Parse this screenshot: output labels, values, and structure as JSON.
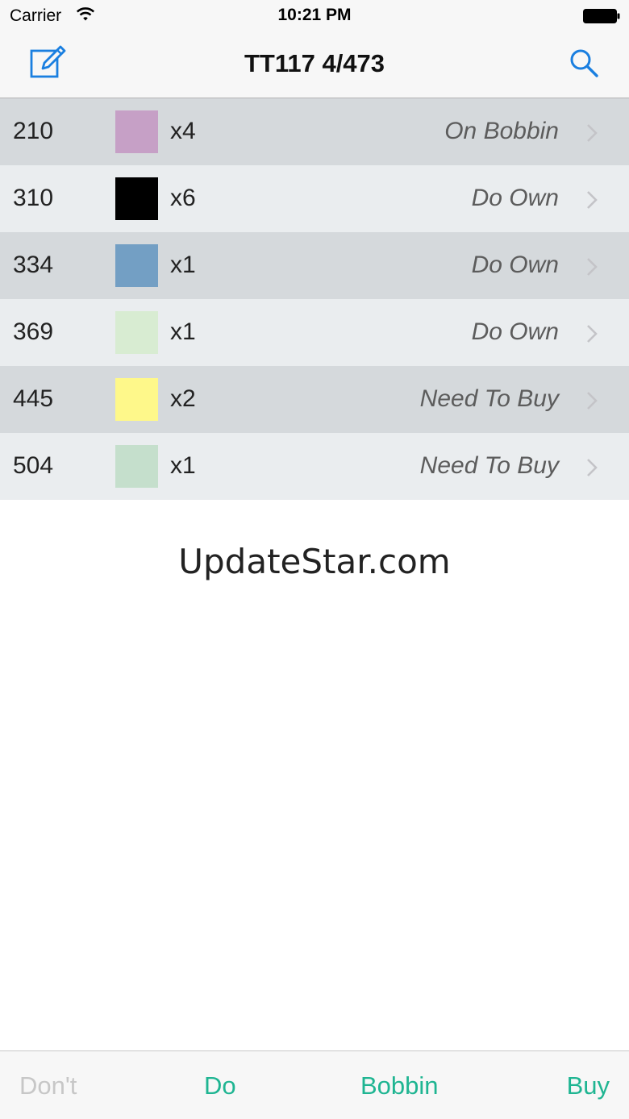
{
  "status_bar": {
    "carrier": "Carrier",
    "time": "10:21 PM",
    "wifi_icon": "wifi-icon",
    "battery_icon": "battery-full-icon"
  },
  "nav": {
    "title": "TT117 4/473",
    "left_icon": "edit-icon",
    "right_icon": "search-icon",
    "accent_color": "#1a7fe0"
  },
  "rows": [
    {
      "code": "210",
      "color": "#c6a0c6",
      "qty": "x4",
      "status": "On Bobbin"
    },
    {
      "code": "310",
      "color": "#000000",
      "qty": "x6",
      "status": "Do Own"
    },
    {
      "code": "334",
      "color": "#739fc4",
      "qty": "x1",
      "status": "Do Own"
    },
    {
      "code": "369",
      "color": "#d8ecd2",
      "qty": "x1",
      "status": "Do Own"
    },
    {
      "code": "445",
      "color": "#fef88a",
      "qty": "x2",
      "status": "Need To Buy"
    },
    {
      "code": "504",
      "color": "#c5dfcc",
      "qty": "x1",
      "status": "Need To Buy"
    }
  ],
  "watermark": "UpdateStar.com",
  "toolbar": {
    "dont_label": "Don't",
    "do_label": "Do",
    "bobbin_label": "Bobbin",
    "buy_label": "Buy",
    "active_color": "#1fb592",
    "disabled_color": "#c7c7c7"
  }
}
